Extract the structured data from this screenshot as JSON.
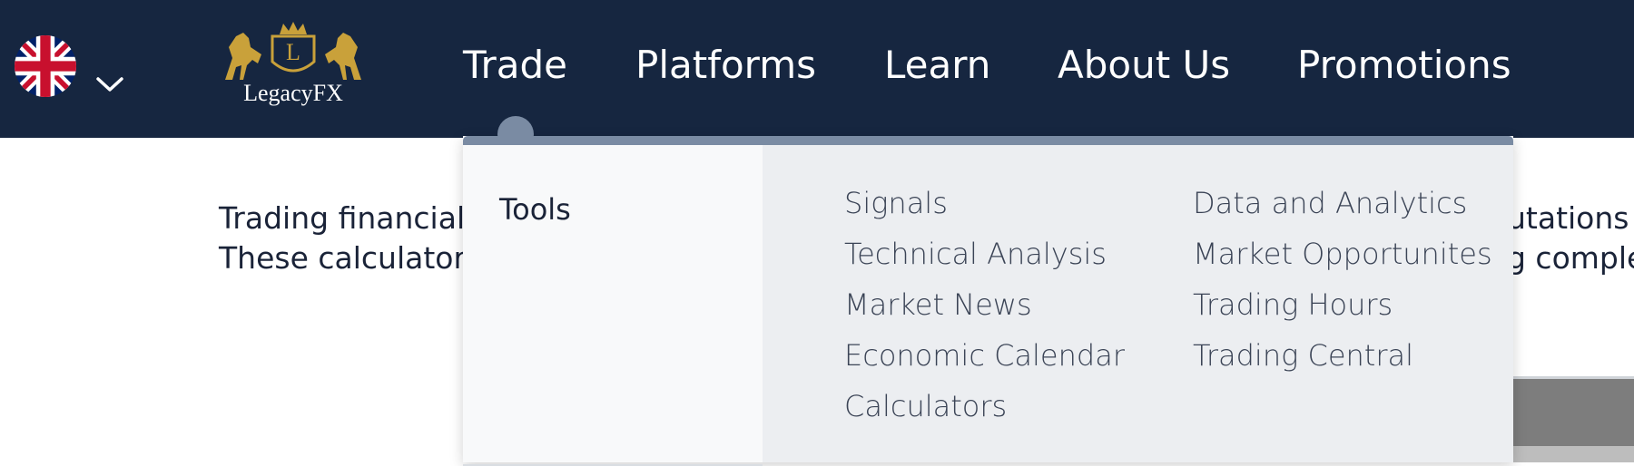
{
  "header": {
    "language_flag": "uk-flag-icon",
    "logo_text": "LegacyFX",
    "nav": [
      "Trade",
      "Platforms",
      "Learn",
      "About Us",
      "Promotions"
    ]
  },
  "page": {
    "line1_left": "Trading financial",
    "line2_left": "These calculators",
    "line1_right": "utations",
    "line2_right": "g comple"
  },
  "dropdown": {
    "category": "Tools",
    "column1": [
      "Signals",
      "Technical Analysis",
      "Market News",
      "Economic Calendar",
      "Calculators"
    ],
    "column2": [
      "Data and Analytics",
      "Market Opportunites",
      "Trading Hours",
      "Trading Central"
    ]
  },
  "colors": {
    "header_bg": "#162640",
    "logo_gold": "#c9a13a",
    "dropdown_bar": "#7a8ba3"
  }
}
